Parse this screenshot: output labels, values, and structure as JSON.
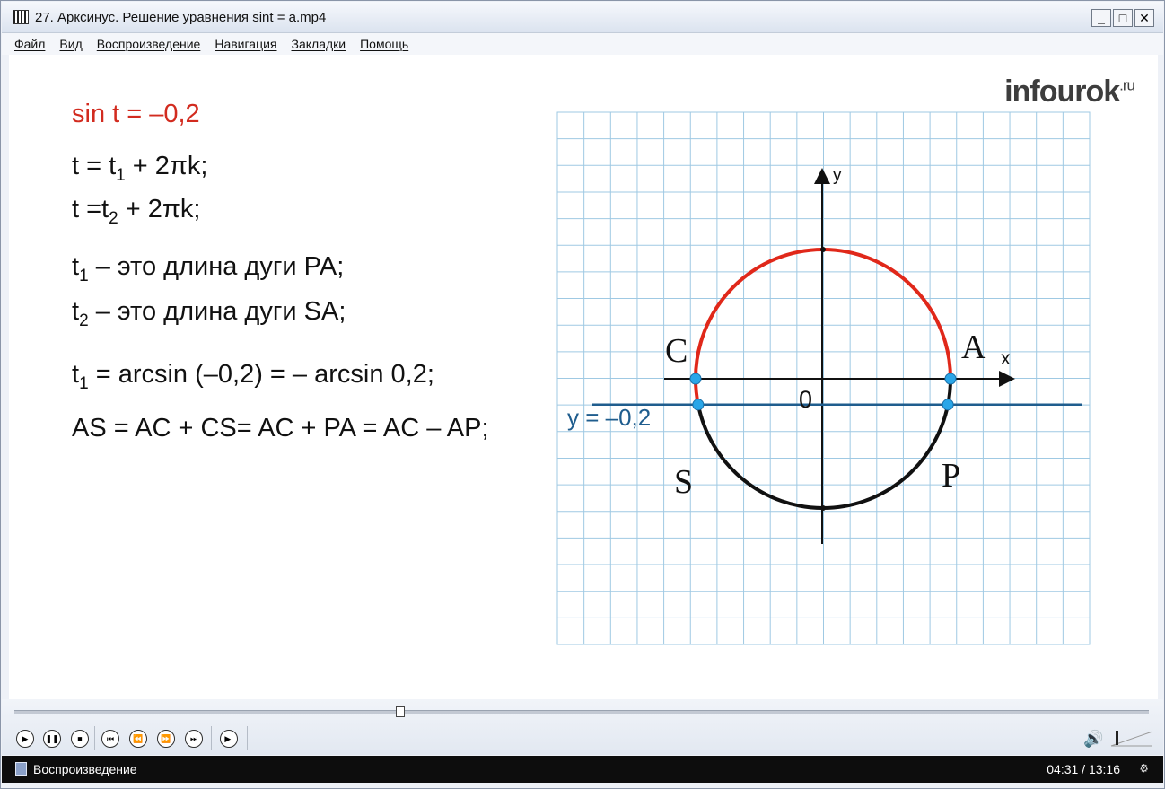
{
  "window": {
    "title": "27. Арксинус. Решение уравнения sint = a.mp4",
    "minimize": "_",
    "maximize": "□",
    "close": "✕"
  },
  "menu": [
    "Файл",
    "Вид",
    "Воспроизведение",
    "Навигация",
    "Закладки",
    "Помощь"
  ],
  "slide": {
    "logo_main": "infourok",
    "logo_suffix": ".ru",
    "equation": "sin t = –0,2",
    "line1_a": "t = t",
    "line1_sub": "1",
    "line1_b": " + 2πk;",
    "line2_a": "t =t",
    "line2_sub": "2",
    "line2_b": " + 2πk;",
    "line3_a": "t",
    "line3_sub": "1",
    "line3_b": " – это длина дуги PA;",
    "line4_a": "t",
    "line4_sub": "2",
    "line4_b": " – это длина дуги SA;",
    "line5_a": "t",
    "line5_sub": "1",
    "line5_b": " = arcsin (–0,2) = – arcsin 0,2;",
    "line6": "AS = AC + CS= AC + PA = AC – AP;",
    "graph": {
      "axis_x_label": "x",
      "axis_y_label": "y",
      "origin_label": "0",
      "point_A": "A",
      "point_C": "C",
      "point_S": "S",
      "point_P": "P",
      "line_label": "y = –0,2",
      "line_y_value": -0.2,
      "colors": {
        "grid": "#9fc9e3",
        "red_arc": "#e0281a",
        "black_arc": "#111111",
        "line": "#1f5d8e",
        "point": "#2aa6e8"
      }
    }
  },
  "player": {
    "status": "Воспроизведение",
    "time": "04:31 / 13:16",
    "progress": 0.34,
    "volume_icon": "speaker-icon",
    "status_menu_icon": "settings-icon"
  }
}
